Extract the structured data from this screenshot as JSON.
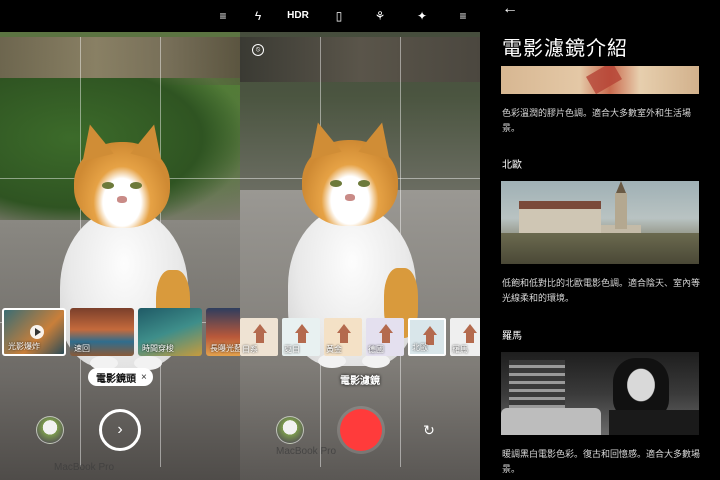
{
  "camera_top_bar": {
    "icons": [
      "menu-icon",
      "flash-off-icon",
      "hdr-icon",
      "stabilize-icon",
      "color-filter-icon",
      "effect-icon",
      "more-icon"
    ],
    "hdr_label": "HDR"
  },
  "left_screen": {
    "film_thumbs": [
      {
        "label": "光影爆炸"
      },
      {
        "label": "速回"
      },
      {
        "label": "時間穿梭"
      },
      {
        "label": "長曝光藍"
      }
    ],
    "chip_label": "電影鏡頭",
    "chip_close": "×",
    "laptop_text": "MacBook Pro",
    "shutter_icon": "›"
  },
  "middle_screen": {
    "filters": [
      {
        "label": "日系",
        "bg": "#efe3d3"
      },
      {
        "label": "夏日",
        "bg": "#e8f1f1"
      },
      {
        "label": "黃金",
        "bg": "#f4e1c6"
      },
      {
        "label": "德國",
        "bg": "#e4e0ef"
      },
      {
        "label": "北歐",
        "bg": "#d9e6ea"
      },
      {
        "label": "羅馬",
        "bg": "#efefef"
      }
    ],
    "caption": "電影濾鏡",
    "laptop_text": "MacBook Pro",
    "flip_icon": "↻",
    "timer_icon": "⦸"
  },
  "article": {
    "back_icon": "←",
    "title": "電影濾鏡介紹",
    "sections": [
      {
        "title": "",
        "desc": "色彩溫潤的膠片色調。適合大多數室外和生活場景。"
      },
      {
        "title": "北歐",
        "desc": "低飽和低對比的北歐電影色調。適合陰天、室內等光線柔和的環境。"
      },
      {
        "title": "羅馬",
        "desc": "暖調黑白電影色彩。復古和回憶感。適合大多數場景。"
      }
    ]
  },
  "colors": {
    "record": "#ff3b3b",
    "background": "#000000"
  }
}
